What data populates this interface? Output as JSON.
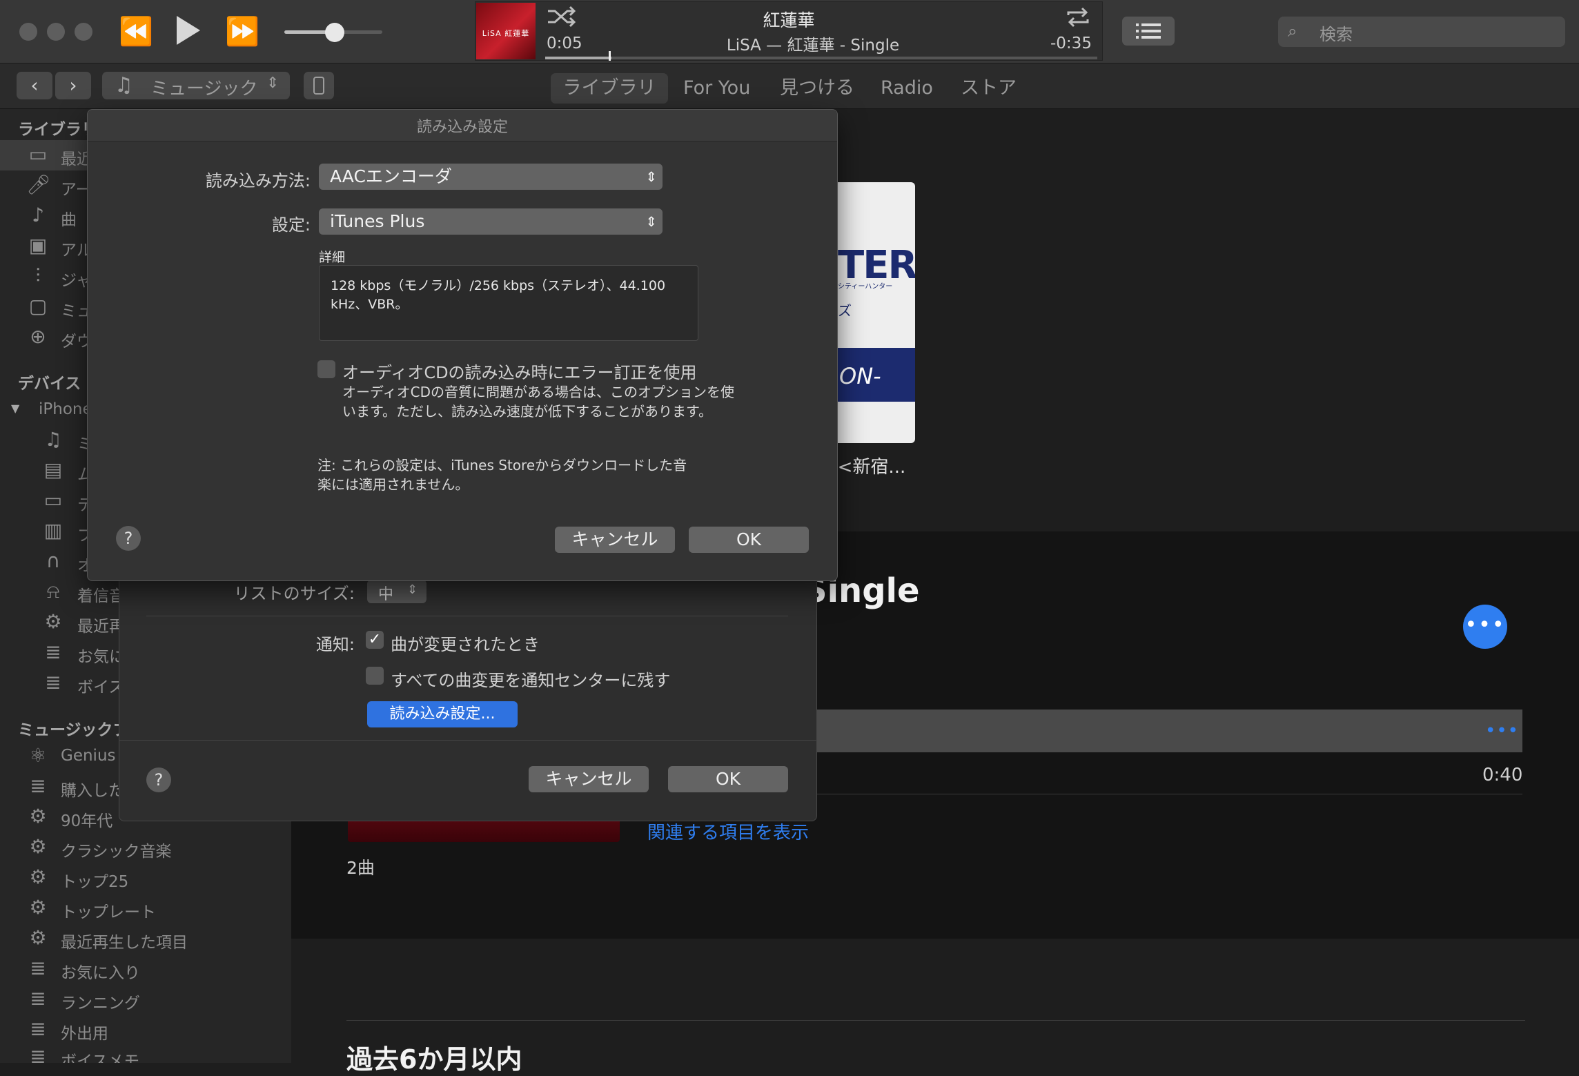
{
  "titlebar": {
    "now_playing_title": "紅蓮華",
    "now_playing_subtitle": "LiSA — 紅蓮華 - Single",
    "elapsed": "0:05",
    "remaining": "-0:35",
    "artwork_text": "LiSA 紅蓮華",
    "search_placeholder": "検索",
    "volume_level": 0.5,
    "progress": 0.12
  },
  "toolbar": {
    "media_kind": "ミュージック",
    "tabs": [
      "ライブラリ",
      "For You",
      "見つける",
      "Radio",
      "ストア"
    ]
  },
  "sidebar": {
    "library_header": "ライブラリ",
    "library_items": [
      "最近",
      "アー",
      "曲",
      "アル",
      "ジャ",
      "ミュ",
      "ダウ"
    ],
    "devices_header": "デバイス",
    "device_name": "iPhone",
    "device_items": [
      "ミ",
      "ム",
      "テ",
      "ブ",
      "オ",
      "着信音",
      "最近再",
      "お気に",
      "ボイス"
    ],
    "playlists_header": "ミュージックプ",
    "playlist_items": [
      "Genius",
      "購入した",
      "90年代",
      "クラシック音楽",
      "トップ25",
      "トップレート",
      "最近再生した項目",
      "お気に入り",
      "ランニング",
      "外出用",
      "ボイスメモ"
    ]
  },
  "main": {
    "album_card_label": "- <新宿...",
    "album_card_art_text": [
      "TER",
      "シティーハンター",
      "ズ",
      "ON-"
    ],
    "single_title": "Single",
    "track_duration": "0:40",
    "related_link": "関連する項目を表示",
    "song_count": "2曲",
    "recent_heading": "過去6か月以内"
  },
  "prefs_dialog": {
    "list_size_label": "リストのサイズ:",
    "list_size_value": "中",
    "notify_label": "通知:",
    "notify_song_change": "曲が変更されたとき",
    "notify_song_change_checked": true,
    "notify_keep_all": "すべての曲変更を通知センターに残す",
    "notify_keep_all_checked": false,
    "import_settings_button": "読み込み設定...",
    "help": "?",
    "cancel": "キャンセル",
    "ok": "OK"
  },
  "import_dialog": {
    "title": "読み込み設定",
    "import_using_label": "読み込み方法:",
    "import_using_value": "AACエンコーダ",
    "setting_label": "設定:",
    "setting_value": "iTunes Plus",
    "details_label": "詳細",
    "details_text": "128 kbps（モノラル）/256 kbps（ステレオ）、44.100 kHz、VBR。",
    "error_correction_label": "オーディオCDの読み込み時にエラー訂正を使用",
    "error_correction_checked": false,
    "error_correction_desc": "オーディオCDの音質に問題がある場合は、このオプションを使います。ただし、読み込み速度が低下することがあります。",
    "note": "注: これらの設定は、iTunes Storeからダウンロードした音楽には適用されません。",
    "help": "?",
    "cancel": "キャンセル",
    "ok": "OK"
  },
  "colors": {
    "accent": "#2f7ef0",
    "window_bg": "#1e1e1e",
    "dialog_bg": "#333333"
  },
  "icons": [
    "close-icon",
    "minimize-icon",
    "zoom-icon",
    "rewind-icon",
    "play-icon",
    "fast-forward-icon",
    "shuffle-icon",
    "repeat-icon",
    "list-icon",
    "search-icon",
    "music-note-icon",
    "iphone-icon",
    "gear-icon",
    "playlist-icon",
    "help-icon",
    "ellipsis-icon"
  ]
}
